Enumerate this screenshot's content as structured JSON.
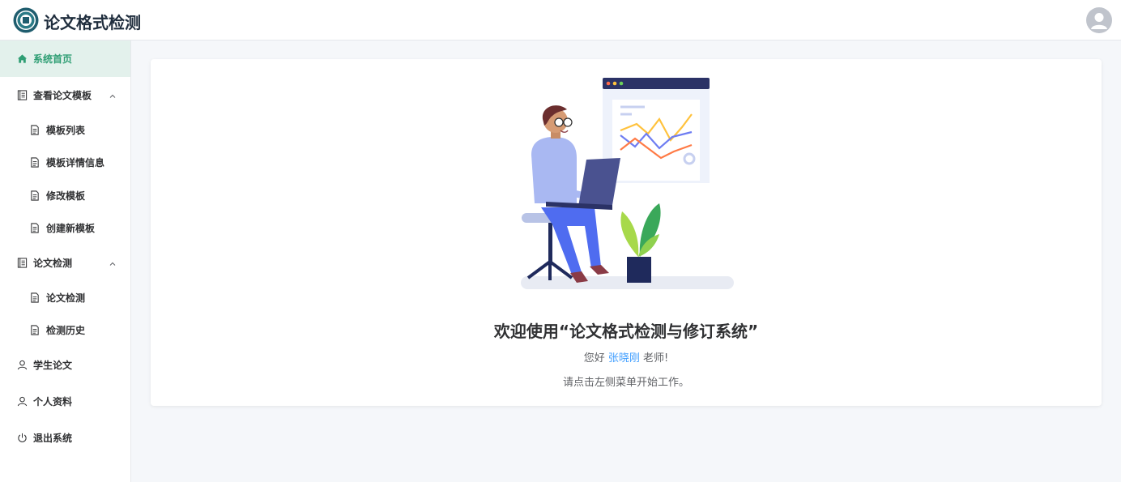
{
  "app": {
    "title": "论文格式检测"
  },
  "sidebar": {
    "items": [
      {
        "label": "系统首页",
        "icon": "home-icon",
        "active": true
      },
      {
        "label": "查看论文模板",
        "icon": "document-list-icon",
        "expanded": true,
        "children": [
          {
            "label": "模板列表",
            "icon": "file-icon"
          },
          {
            "label": "模板详情信息",
            "icon": "file-icon"
          },
          {
            "label": "修改模板",
            "icon": "file-icon"
          },
          {
            "label": "创建新模板",
            "icon": "file-icon"
          }
        ]
      },
      {
        "label": "论文检测",
        "icon": "document-list-icon",
        "expanded": true,
        "children": [
          {
            "label": "论文检测",
            "icon": "file-icon"
          },
          {
            "label": "检测历史",
            "icon": "file-icon"
          }
        ]
      },
      {
        "label": "学生论文",
        "icon": "user-icon"
      },
      {
        "label": "个人资料",
        "icon": "user-icon"
      },
      {
        "label": "退出系统",
        "icon": "power-icon"
      }
    ]
  },
  "main": {
    "welcome_title": "欢迎使用“论文格式检测与修订系统”",
    "greeting_prefix": "您好",
    "user_name": "张晓刚",
    "greeting_suffix": "老师!",
    "hint": "请点击左侧菜单开始工作。"
  },
  "colors": {
    "accent": "#2f9e74",
    "active_bg": "#e3f1ec",
    "link": "#409eff",
    "main_bg": "#f5f7fa"
  }
}
